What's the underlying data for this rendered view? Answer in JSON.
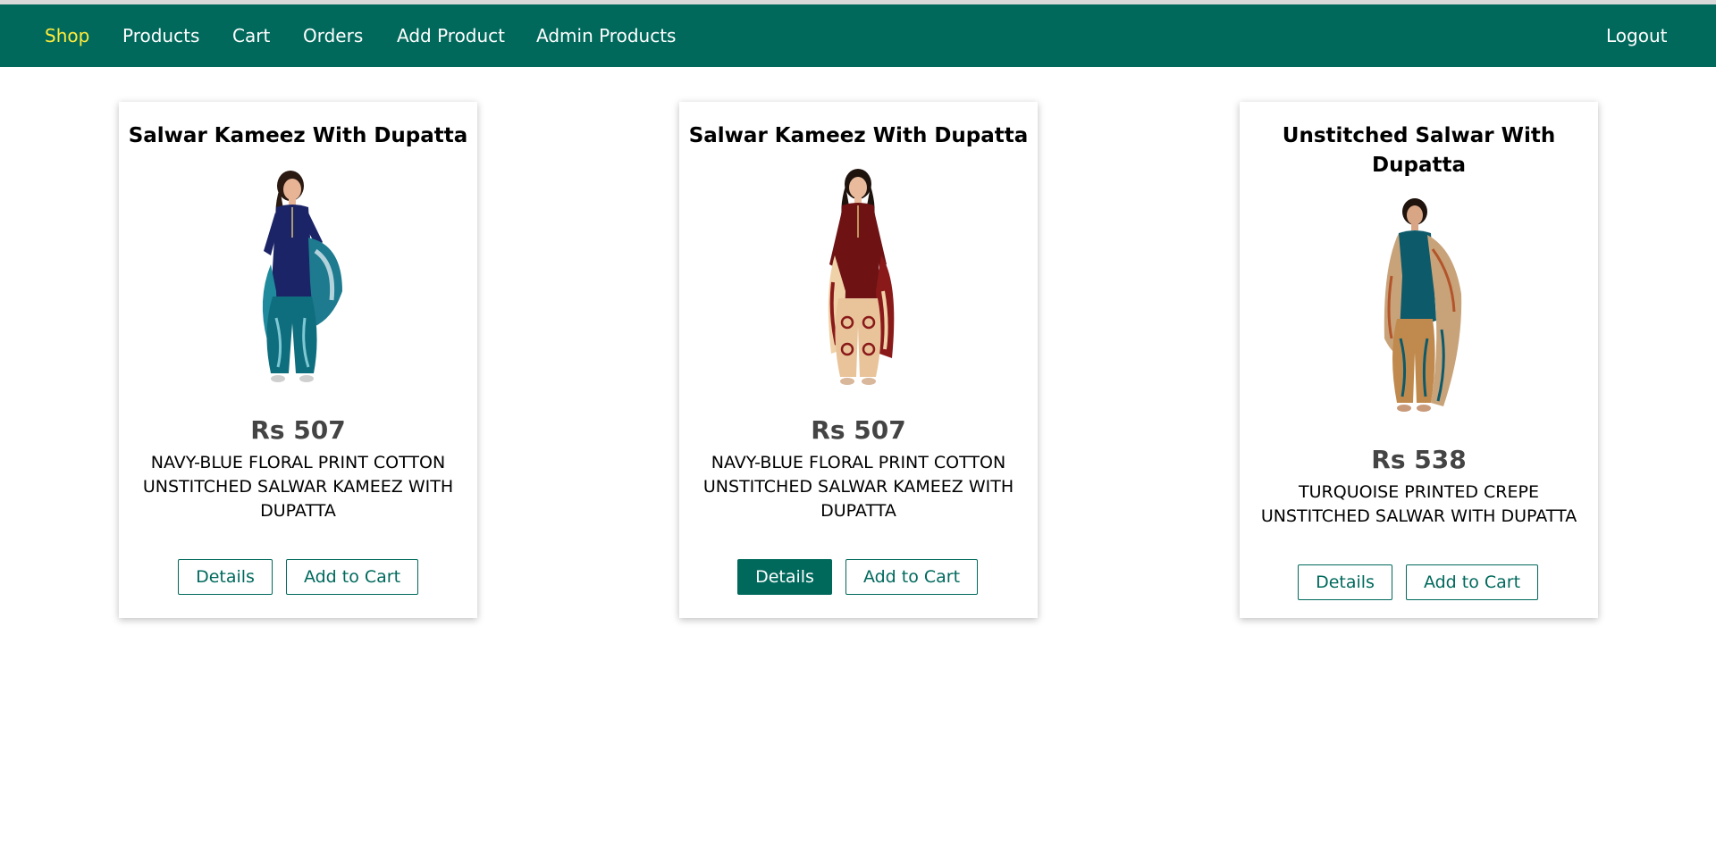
{
  "nav": {
    "items": [
      {
        "label": "Shop",
        "active": true
      },
      {
        "label": "Products",
        "active": false
      },
      {
        "label": "Cart",
        "active": false
      },
      {
        "label": "Orders",
        "active": false
      },
      {
        "label": "Add Product",
        "active": false
      },
      {
        "label": "Admin Products",
        "active": false
      }
    ],
    "logout_label": "Logout"
  },
  "colors": {
    "nav_background": "#00695c",
    "nav_active": "#ffeb3b",
    "button_accent": "#00695c"
  },
  "products": [
    {
      "title": "Salwar Kameez With Dupatta",
      "price": "Rs 507",
      "description": "NAVY-BLUE FLORAL PRINT COTTON UNSTITCHED SALWAR KAMEEZ WITH DUPATTA",
      "details_label": "Details",
      "add_to_cart_label": "Add to Cart"
    },
    {
      "title": "Salwar Kameez With Dupatta",
      "price": "Rs 507",
      "description": "NAVY-BLUE FLORAL PRINT COTTON UNSTITCHED SALWAR KAMEEZ WITH DUPATTA",
      "details_label": "Details",
      "add_to_cart_label": "Add to Cart"
    },
    {
      "title": "Unstitched Salwar With Dupatta",
      "price": "Rs 538",
      "description": "TURQUOISE PRINTED CREPE UNSTITCHED SALWAR WITH DUPATTA",
      "details_label": "Details",
      "add_to_cart_label": "Add to Cart"
    }
  ]
}
